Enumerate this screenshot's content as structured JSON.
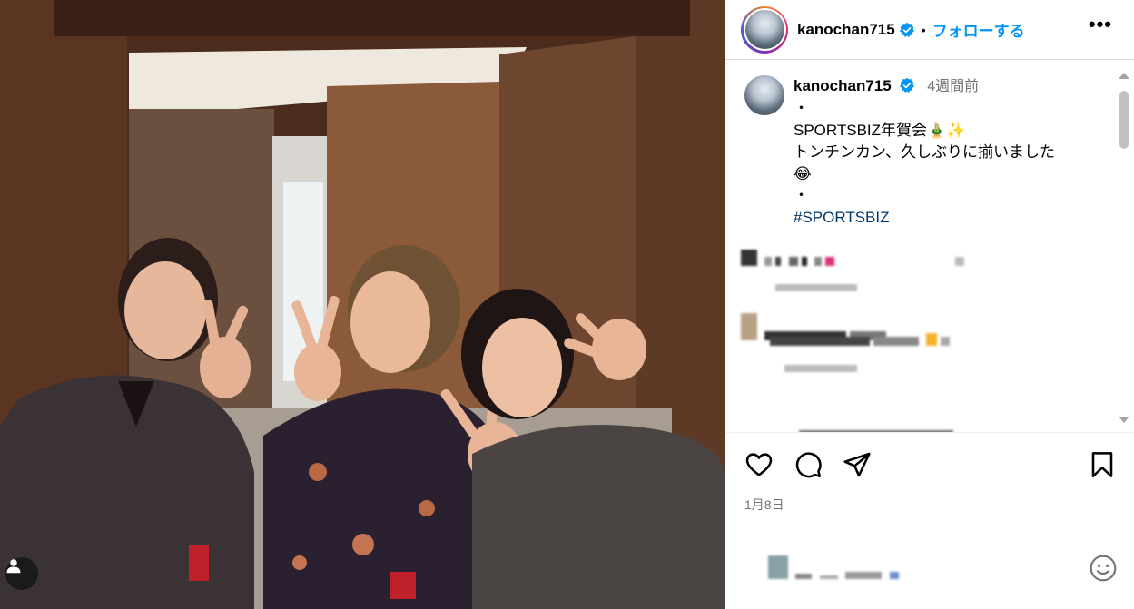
{
  "post": {
    "username": "kanochan715",
    "follow_label": "フォローする",
    "more_label": "•••"
  },
  "caption": {
    "username": "kanochan715",
    "time_ago": "4週間前",
    "line1": "・",
    "line2": "SPORTSBIZ年賀会🎍✨",
    "line3": "トンチンカン、久しぶりに揃いました",
    "line4": "😂",
    "line5": "・",
    "hashtag": "#SPORTSBIZ"
  },
  "footer": {
    "date": "1月8日"
  },
  "icons": {
    "like": "heart-icon",
    "comment": "comment-icon",
    "share": "share-icon",
    "save": "bookmark-icon",
    "emoji": "smiley-icon",
    "tag": "user-tag-icon"
  },
  "colors": {
    "follow_blue": "#0095f6",
    "hashtag_blue": "#00376b",
    "verified_blue": "#0095f6",
    "muted_text": "#737373"
  }
}
